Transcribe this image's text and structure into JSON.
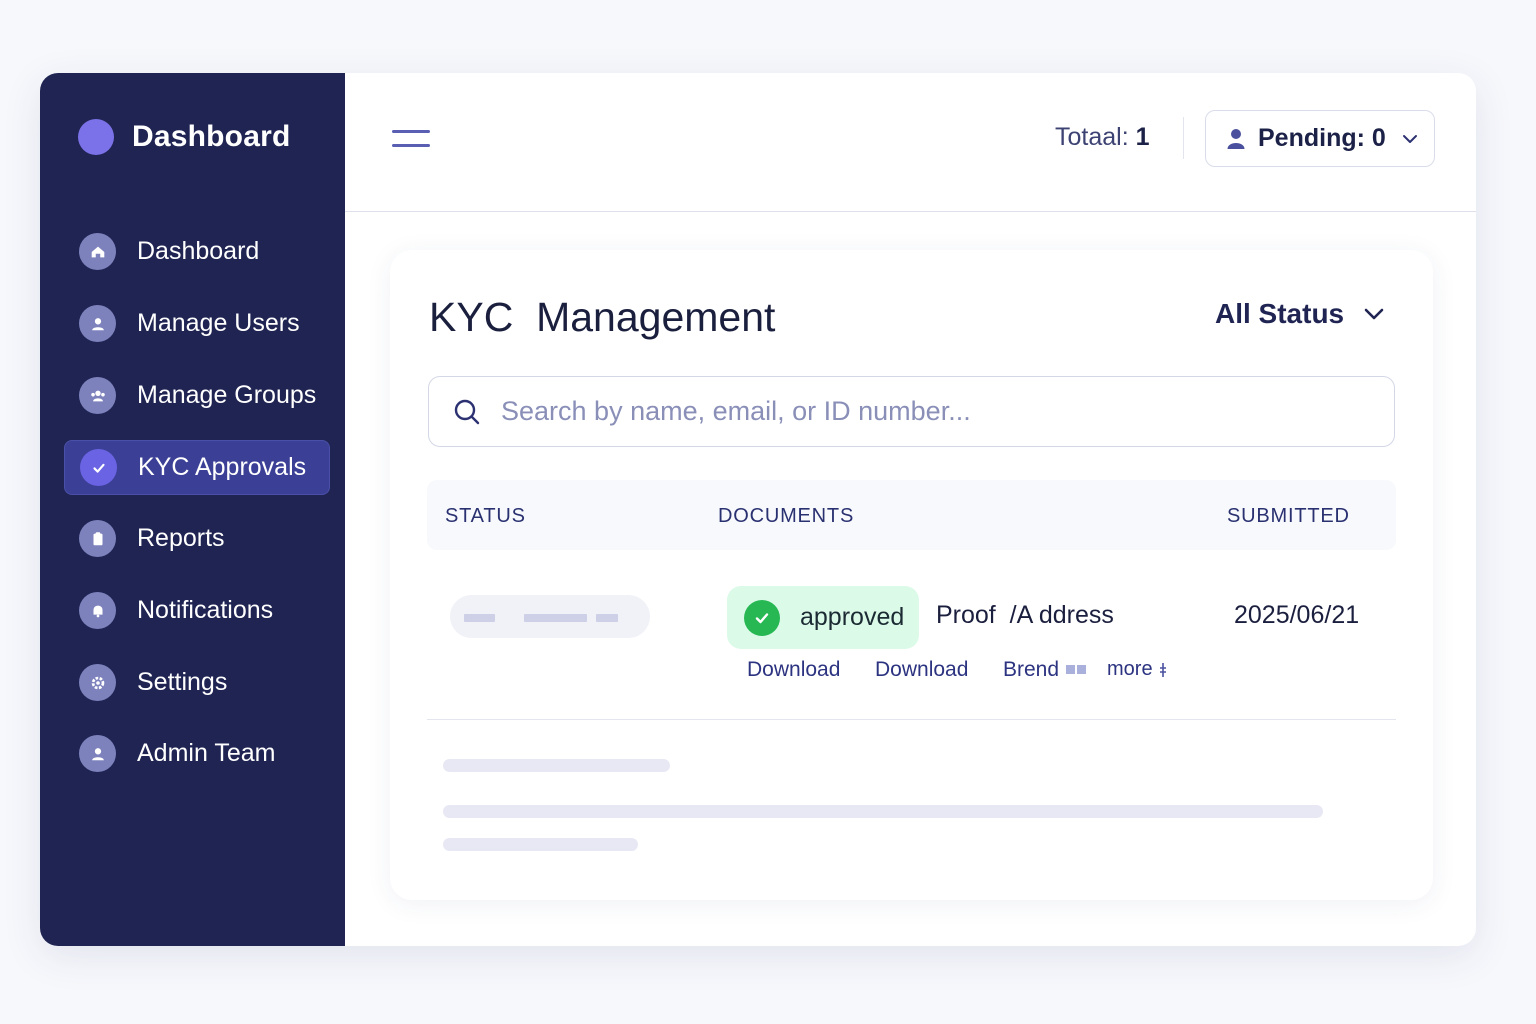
{
  "sidebar": {
    "brand_title": "Dashboard",
    "items": [
      {
        "label": "Dashboard",
        "icon": "home-icon"
      },
      {
        "label": "Manage Users",
        "icon": "user-icon"
      },
      {
        "label": "Manage Groups",
        "icon": "group-icon"
      },
      {
        "label": "KYC Approvals",
        "icon": "check-icon",
        "active": true
      },
      {
        "label": "Reports",
        "icon": "clipboard-icon"
      },
      {
        "label": "Notifications",
        "icon": "bell-icon"
      },
      {
        "label": "Settings",
        "icon": "gear-icon"
      },
      {
        "label": "Admin Team",
        "icon": "user-icon"
      }
    ]
  },
  "topbar": {
    "total_label": "Totaal:",
    "total_value": "1",
    "pending_label": "Pending: 0"
  },
  "kyc": {
    "title": "KYC  Management",
    "status_filter": "All Status",
    "search_placeholder": "Search by name, email, or ID number...",
    "columns": {
      "status": "STATUS",
      "documents": "DOCUMENTS",
      "submitted": "SUBMITTED"
    },
    "row": {
      "badge": "approved",
      "document": "Proof  /A ddress",
      "submitted": "2025/06/21",
      "links": [
        "Download",
        "Download",
        "Brend"
      ],
      "more": "more"
    }
  },
  "colors": {
    "sidebar_bg": "#1f2452",
    "accent": "#6a63e4",
    "approved_bg": "#dcfae8",
    "approved_icon": "#27b854"
  }
}
